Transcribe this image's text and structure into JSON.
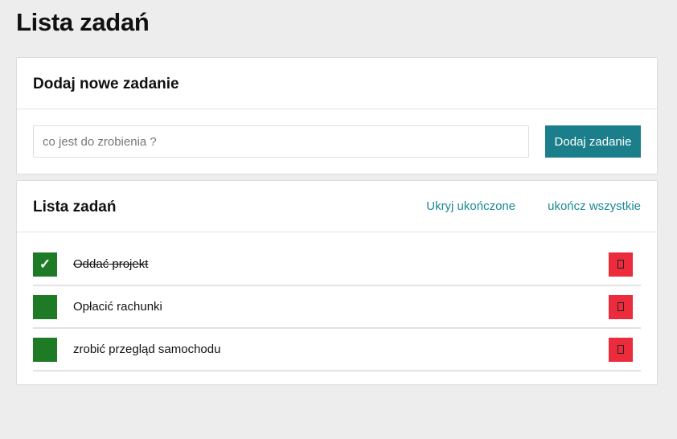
{
  "page": {
    "title": "Lista zadań"
  },
  "add_card": {
    "title": "Dodaj nowe zadanie",
    "input_placeholder": "co jest do zrobienia ?",
    "input_value": "",
    "button_label": "Dodaj zadanie"
  },
  "list_card": {
    "title": "Lista zadań",
    "hide_completed_label": "Ukryj ukończone",
    "complete_all_label": "ukończ wszystkie",
    "tasks": [
      {
        "text": "Oddać projekt",
        "done": true,
        "check_glyph": "✓"
      },
      {
        "text": "Opłacić rachunki",
        "done": false,
        "check_glyph": ""
      },
      {
        "text": "zrobić przegląd samochodu",
        "done": false,
        "check_glyph": ""
      }
    ]
  },
  "colors": {
    "accent_button": "#1a7f8a",
    "link": "#1a8a94",
    "checkbox": "#1e7b25",
    "delete": "#ec2b3d",
    "background": "#ededed"
  },
  "icons": {
    "check": "checkmark-icon",
    "delete": "delete-icon"
  }
}
